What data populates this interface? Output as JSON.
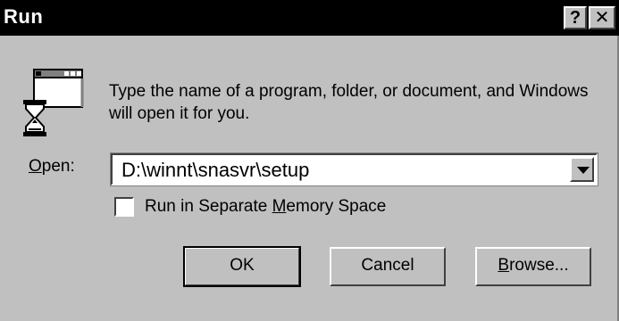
{
  "window": {
    "title": "Run",
    "help_button": "?",
    "close_button": "✕"
  },
  "prompt": "Type the name of a program, folder, or document, and Windows will open it for you.",
  "open": {
    "label_accel": "O",
    "label_rest": "pen:",
    "value": "D:\\winnt\\snasvr\\setup"
  },
  "separate_memory": {
    "checked": false,
    "label_pre": "Run in Separate ",
    "label_accel": "M",
    "label_post": "emory Space"
  },
  "buttons": {
    "ok": "OK",
    "cancel": "Cancel",
    "browse_accel": "B",
    "browse_rest": "rowse..."
  },
  "icons": {
    "app": "run-program-icon",
    "dropdown": "dropdown-arrow-icon"
  },
  "colors": {
    "titlebar": "#000000",
    "face": "#c0c0c0"
  }
}
